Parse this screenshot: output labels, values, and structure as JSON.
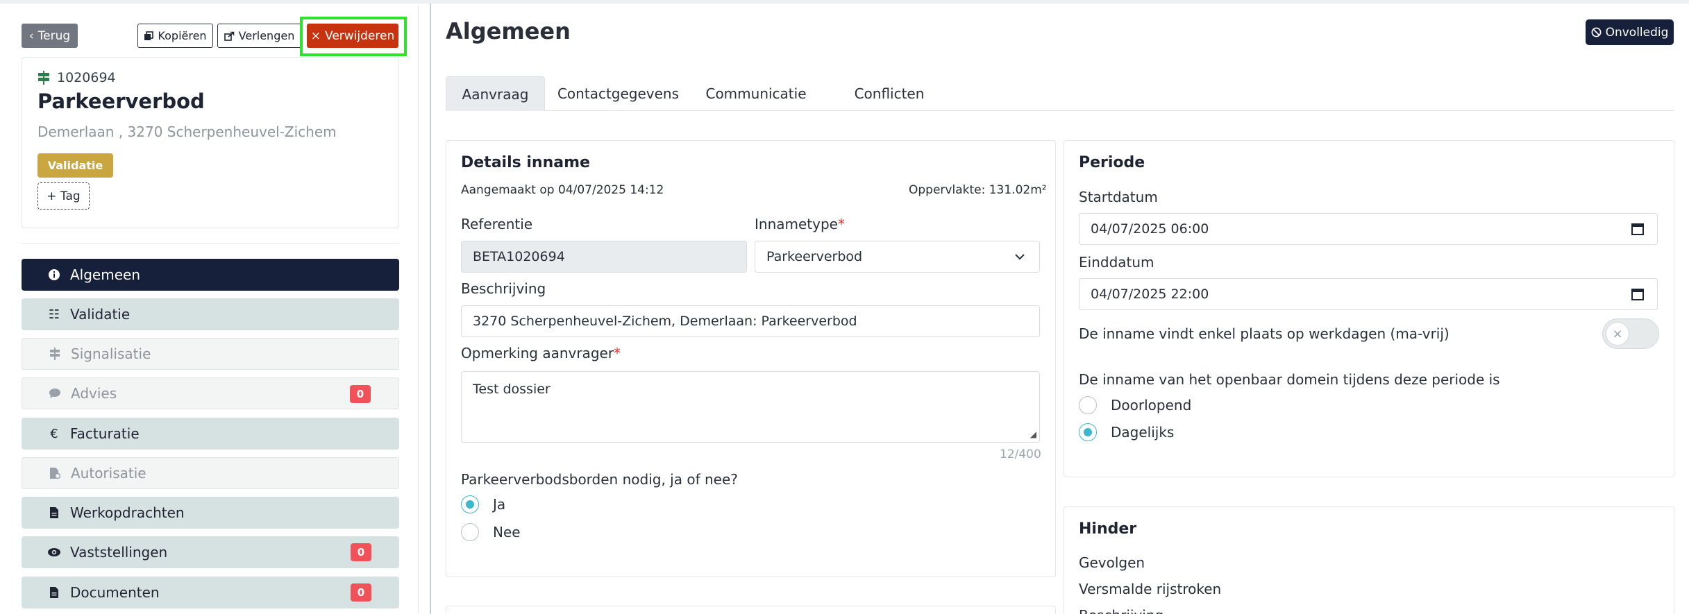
{
  "toolbar": {
    "back_label": "Terug",
    "copy_label": "Kopiëren",
    "extend_label": "Verlengen",
    "delete_label": "Verwijderen"
  },
  "dossier": {
    "id": "1020694",
    "title": "Parkeerverbod",
    "address": "Demerlaan , 3270 Scherpenheuvel-Zichem",
    "status_badge": "Validatie",
    "tag_button": "+ Tag"
  },
  "sidebar": {
    "items": [
      {
        "label": "Algemeen",
        "icon": "info-icon",
        "state": "active"
      },
      {
        "label": "Validatie",
        "icon": "checklist-icon",
        "state": "enabled"
      },
      {
        "label": "Signalisatie",
        "icon": "signpost-icon",
        "state": "disabled"
      },
      {
        "label": "Advies",
        "icon": "chat-icon",
        "state": "disabled",
        "count": "0"
      },
      {
        "label": "Facturatie",
        "icon": "euro-icon",
        "state": "enabled"
      },
      {
        "label": "Autorisatie",
        "icon": "file-check-icon",
        "state": "disabled"
      },
      {
        "label": "Werkopdrachten",
        "icon": "document-icon",
        "state": "enabled"
      },
      {
        "label": "Vaststellingen",
        "icon": "eye-icon",
        "state": "enabled",
        "count": "0"
      },
      {
        "label": "Documenten",
        "icon": "document-icon",
        "state": "enabled",
        "count": "0"
      }
    ]
  },
  "header": {
    "title": "Algemeen",
    "status": "Onvolledig"
  },
  "tabs": [
    "Aanvraag",
    "Contactgegevens",
    "Communicatie",
    "Conflicten"
  ],
  "details": {
    "title": "Details inname",
    "created": "Aangemaakt op 04/07/2025 14:12",
    "area": "Oppervlakte: 131.02m²",
    "reference_label": "Referentie",
    "reference_value": "BETA1020694",
    "type_label": "Innametype",
    "type_value": "Parkeerverbod",
    "description_label": "Beschrijving",
    "description_value": "3270 Scherpenheuvel-Zichem, Demerlaan: Parkeerverbod",
    "remark_label": "Opmerking aanvrager",
    "remark_value": "Test dossier",
    "remark_counter": "12/400",
    "signs_question": "Parkeerverbodsborden nodig, ja of nee?",
    "signs_yes": "Ja",
    "signs_no": "Nee",
    "required_mark": "*"
  },
  "period": {
    "title": "Periode",
    "start_label": "Startdatum",
    "start_value": "04/07/2025 06:00",
    "end_label": "Einddatum",
    "end_value": "04/07/2025 22:00",
    "weekdays_label": "De inname vindt enkel plaats op werkdagen (ma-vrij)",
    "mode_question": "De inname van het openbaar domein tijdens deze periode is",
    "mode_continuous": "Doorlopend",
    "mode_daily": "Dagelijks"
  },
  "hinder": {
    "title": "Hinder",
    "consequences_label": "Gevolgen",
    "narrowed_lanes": "Versmalde rijstroken",
    "description_cut": "Beschrijving"
  },
  "colors": {
    "navy": "#17203a",
    "delete_red": "#c6330e",
    "highlight_green": "#2ee32b",
    "validatie_gold": "#c9a640",
    "radio_teal": "#3bb8c9"
  }
}
